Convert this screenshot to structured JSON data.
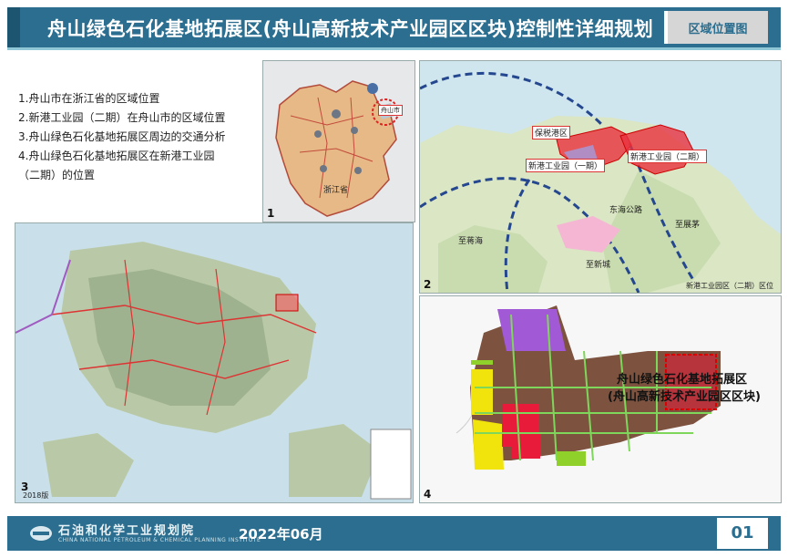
{
  "header": {
    "title": "舟山绿色石化基地拓展区(舟山高新技术产业园区区块)控制性详细规划",
    "tag": "区域位置图"
  },
  "notes": {
    "items": [
      "1.舟山市在浙江省的区域位置",
      "2.新港工业园（二期）在舟山市的区域位置",
      "3.舟山绿色石化基地拓展区周边的交通分析",
      "4.舟山绿色石化基地拓展区在新港工业园",
      "（二期）的位置"
    ]
  },
  "panels": {
    "p1": {
      "num": "1",
      "labels": [
        "浙江省",
        "舟山市"
      ]
    },
    "p2": {
      "num": "2",
      "labels": [
        "保税港区",
        "新港工业园（一期）",
        "新港工业园（二期）",
        "东海公路",
        "至蒋海",
        "至新城",
        "至展茅"
      ],
      "footnote": "新港工业园区（二期）区位"
    },
    "p3": {
      "num": "3",
      "footnote": "2018版"
    },
    "p4": {
      "num": "4",
      "caption_line1": "舟山绿色石化基地拓展区",
      "caption_line2": "(舟山高新技术产业园区区块)"
    }
  },
  "footer": {
    "org": "石油和化学工业规划院",
    "org_en": "CHINA NATIONAL PETROLEUM & CHEMICAL PLANNING INSTITUTE",
    "date": "2022年06月",
    "page": "01"
  }
}
